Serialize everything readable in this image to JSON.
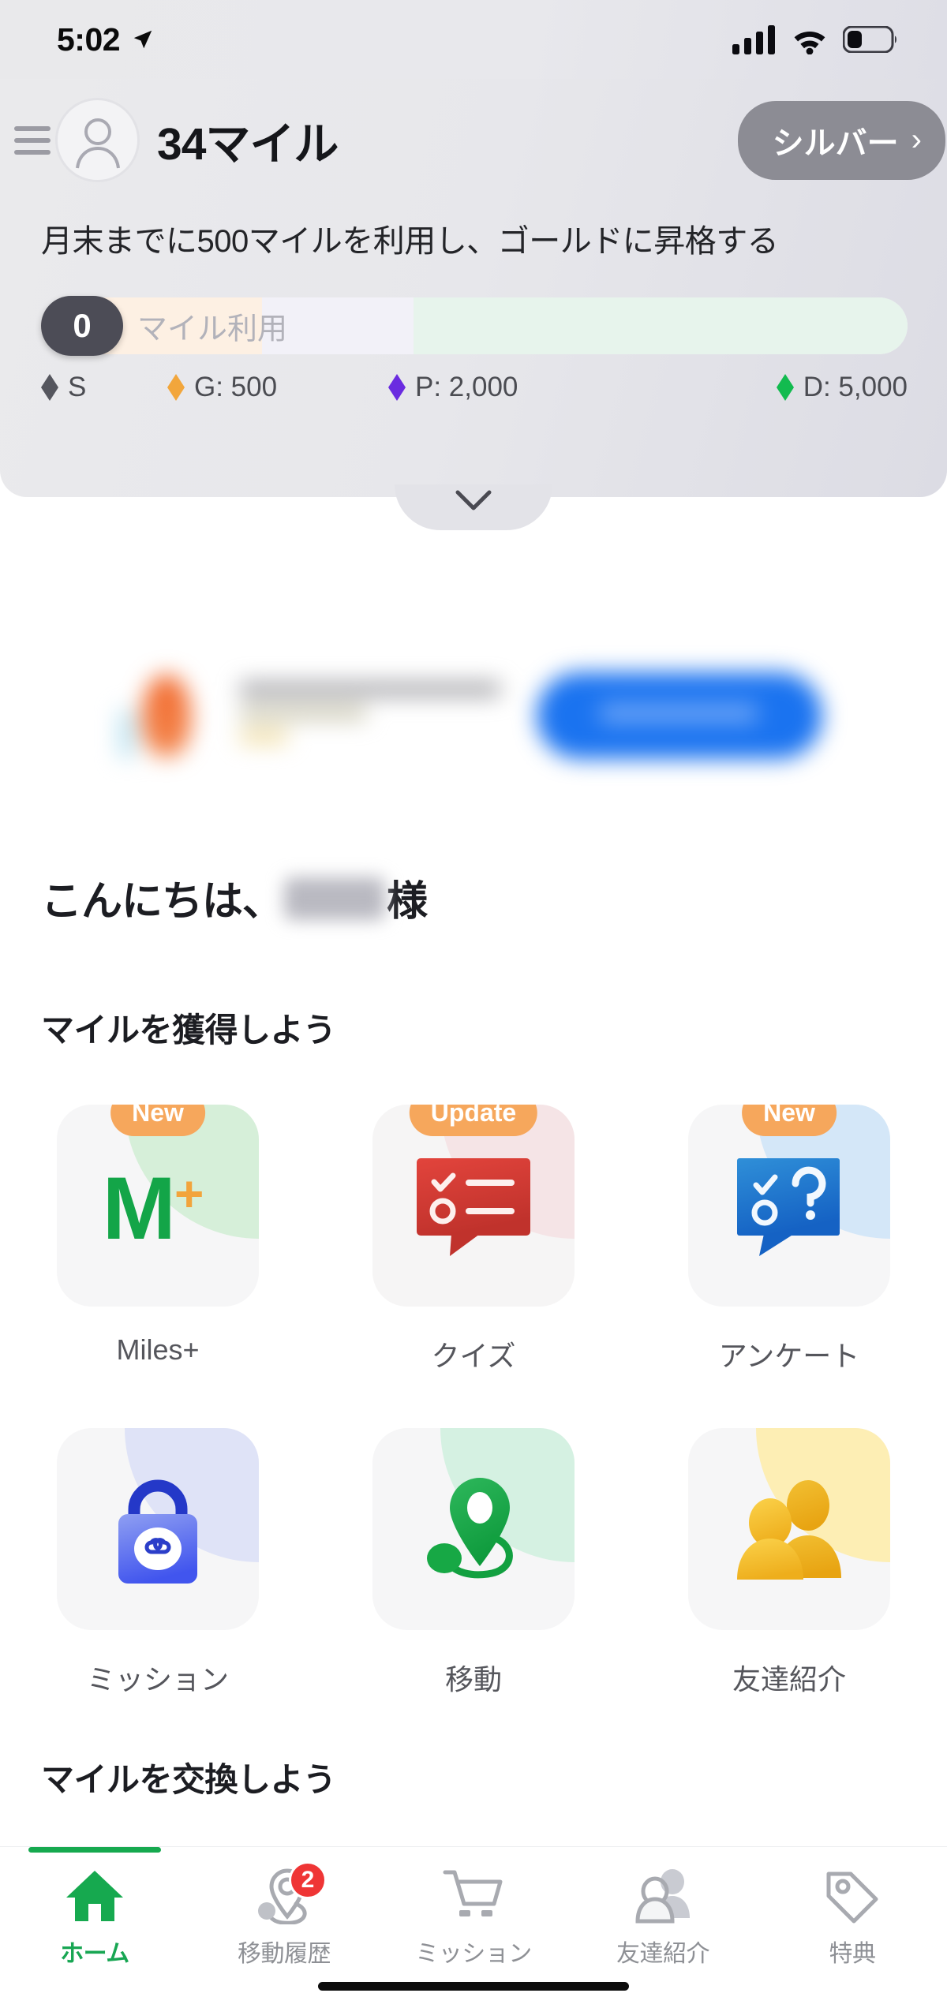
{
  "status_bar": {
    "time": "5:02",
    "location_icon": "location-arrow-icon",
    "signal_icon": "cellular-signal-icon",
    "wifi_icon": "wifi-icon",
    "battery_icon": "battery-low-icon"
  },
  "header": {
    "menu_icon": "hamburger-menu-icon",
    "avatar_icon": "user-avatar-icon",
    "miles_title": "34マイル",
    "tier_label": "シルバー",
    "tier_chevron": "›",
    "subtitle": "月末までに500マイルを利用し、ゴールドに昇格する",
    "collapse_icon": "chevron-down-icon",
    "progress": {
      "current_value": "0",
      "label": "マイル利用",
      "fill_percent": 0
    },
    "tiers": [
      {
        "code": "S",
        "label": "S",
        "color": "#55565e"
      },
      {
        "code": "G",
        "label": "G: 500",
        "color": "#f2a63c"
      },
      {
        "code": "P",
        "label": "P: 2,000",
        "color": "#6a2be0"
      },
      {
        "code": "D",
        "label": "D: 5,000",
        "color": "#12bb4f"
      }
    ]
  },
  "greeting": {
    "prefix": "こんにちは、",
    "suffix": "様"
  },
  "sections": {
    "earn_title": "マイルを獲得しよう",
    "exchange_title": "マイルを交換しよう"
  },
  "earn_cards": [
    {
      "label": "Miles+",
      "badge": "New",
      "icon": "miles-plus-logo-icon",
      "accent": "#d6efd9",
      "card_bg": "#f6f6f7"
    },
    {
      "label": "クイズ",
      "badge": "Update",
      "icon": "quiz-bubble-icon",
      "accent": "#f5e4e6",
      "card_bg": "#f6f5f5"
    },
    {
      "label": "アンケート",
      "badge": "New",
      "icon": "survey-bubble-icon",
      "accent": "#d4e7f8",
      "card_bg": "#f6f6f7"
    },
    {
      "label": "ミッション",
      "badge": "",
      "icon": "shopping-bag-icon",
      "accent": "#dfe3f7",
      "card_bg": "#f6f6f7"
    },
    {
      "label": "移動",
      "badge": "",
      "icon": "location-route-icon",
      "accent": "#d5f1e2",
      "card_bg": "#f6f6f7"
    },
    {
      "label": "友達紹介",
      "badge": "",
      "icon": "two-people-icon",
      "accent": "#fdeeb4",
      "card_bg": "#f6f6f7"
    }
  ],
  "bottom_nav": [
    {
      "label": "ホーム",
      "icon": "home-icon",
      "active": true,
      "badge": ""
    },
    {
      "label": "移動履歴",
      "icon": "route-pin-icon",
      "active": false,
      "badge": "2"
    },
    {
      "label": "ミッション",
      "icon": "shopping-cart-icon",
      "active": false,
      "badge": ""
    },
    {
      "label": "友達紹介",
      "icon": "people-icon",
      "active": false,
      "badge": ""
    },
    {
      "label": "特典",
      "icon": "tag-icon",
      "active": false,
      "badge": ""
    }
  ],
  "colors": {
    "brand_green": "#16a94f",
    "badge_orange": "#f6a75c",
    "notification_red": "#ef3535",
    "tier_gray": "#8c8c94"
  }
}
